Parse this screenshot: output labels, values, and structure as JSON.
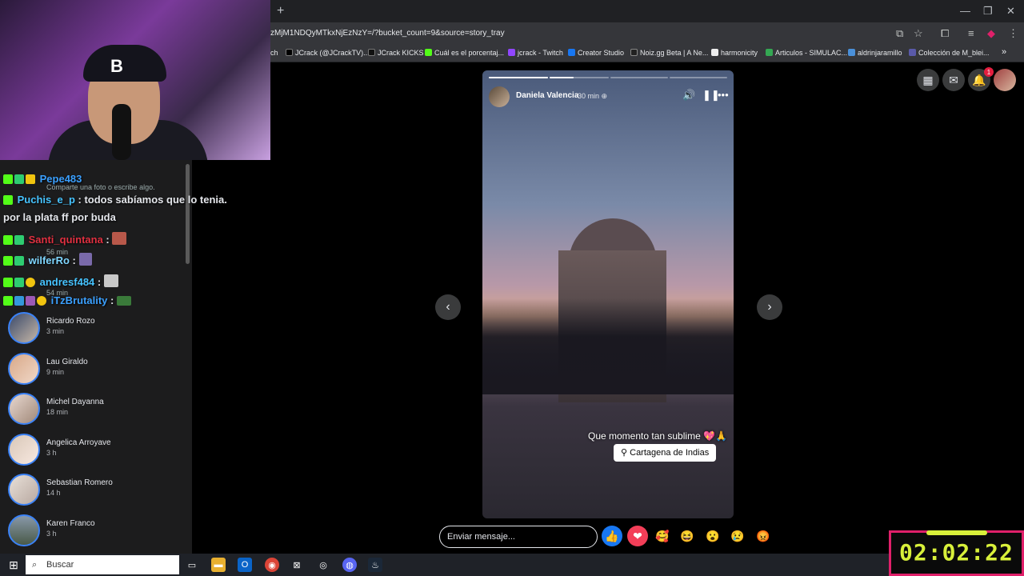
{
  "browser": {
    "new_tab": "+",
    "url": "zMjM1NDQyMTkxNjEzNzY=/?bucket_count=9&source=story_tray",
    "bookmarks": [
      {
        "label": "ch",
        "color": "#888"
      },
      {
        "label": "JCrack (@JCrackTV)...",
        "color": "#000"
      },
      {
        "label": "JCrack KICKS",
        "color": "#111"
      },
      {
        "label": "Cuál es el porcentaj...",
        "color": "#53fc18"
      },
      {
        "label": "jcrack - Twitch",
        "color": "#9146ff"
      },
      {
        "label": "Creator Studio",
        "color": "#1877f2"
      },
      {
        "label": "Noiz.gg Beta | A Ne...",
        "color": "#222"
      },
      {
        "label": "harmonicity",
        "color": "#eee"
      },
      {
        "label": "Articulos - SIMULAC...",
        "color": "#34a853"
      },
      {
        "label": "aldrinjaramillo",
        "color": "#4a90d9"
      },
      {
        "label": "Colección de M_blei...",
        "color": "#5a5aaa"
      }
    ],
    "more": "»"
  },
  "chat": [
    {
      "user": "Pepe483",
      "text": "",
      "color": "#3ba0ff"
    },
    {
      "user": "Puchis_e_p",
      "text": " : todos sabíamos que lo tenia.",
      "color": "#46c3ff"
    },
    {
      "user": "",
      "text": "por la plata ff por buda",
      "color": "#fff"
    },
    {
      "user": "Santi_quintana",
      "text": " :",
      "color": "#e03040"
    },
    {
      "user": "wilferRo",
      "text": " :",
      "color": "#7fd6ff"
    },
    {
      "user": "andresf484",
      "text": " :",
      "color": "#46c3ff"
    },
    {
      "user": "iTzBrutality",
      "text": " :",
      "color": "#3ba0ff"
    }
  ],
  "sidebar": {
    "create_hint": "Comparte una foto o escribe algo.",
    "ghost_times": [
      "56 min",
      "54 min"
    ],
    "stories": [
      {
        "name": "Ricardo Rozo",
        "time": "3 min"
      },
      {
        "name": "Lau Giraldo",
        "time": "9 min"
      },
      {
        "name": "Michel Dayanna",
        "time": "18 min"
      },
      {
        "name": "Angelica Arroyave",
        "time": "3 h"
      },
      {
        "name": "Sebastian Romero",
        "time": "14 h"
      },
      {
        "name": "Karen Franco",
        "time": "3 h"
      }
    ]
  },
  "story": {
    "author": "Daniela Valencia",
    "time": "30 min",
    "caption": "Que momento tan sublime 💖🙏",
    "location": "Cartagena de Indias",
    "segments": [
      1,
      0.4,
      0,
      0
    ],
    "reply_placeholder": "Enviar mensaje..."
  },
  "reactions": [
    {
      "name": "like",
      "glyph": "👍",
      "bg": "#1877f2"
    },
    {
      "name": "love",
      "glyph": "❤",
      "bg": "#f33e58"
    },
    {
      "name": "care",
      "glyph": "🥰",
      "bg": "transparent"
    },
    {
      "name": "haha",
      "glyph": "😆",
      "bg": "transparent"
    },
    {
      "name": "wow",
      "glyph": "😮",
      "bg": "transparent"
    },
    {
      "name": "sad",
      "glyph": "😢",
      "bg": "transparent"
    },
    {
      "name": "angry",
      "glyph": "😡",
      "bg": "transparent"
    }
  ],
  "notifications_count": "1",
  "taskbar": {
    "search": "Buscar"
  },
  "timer": "02:02:22"
}
